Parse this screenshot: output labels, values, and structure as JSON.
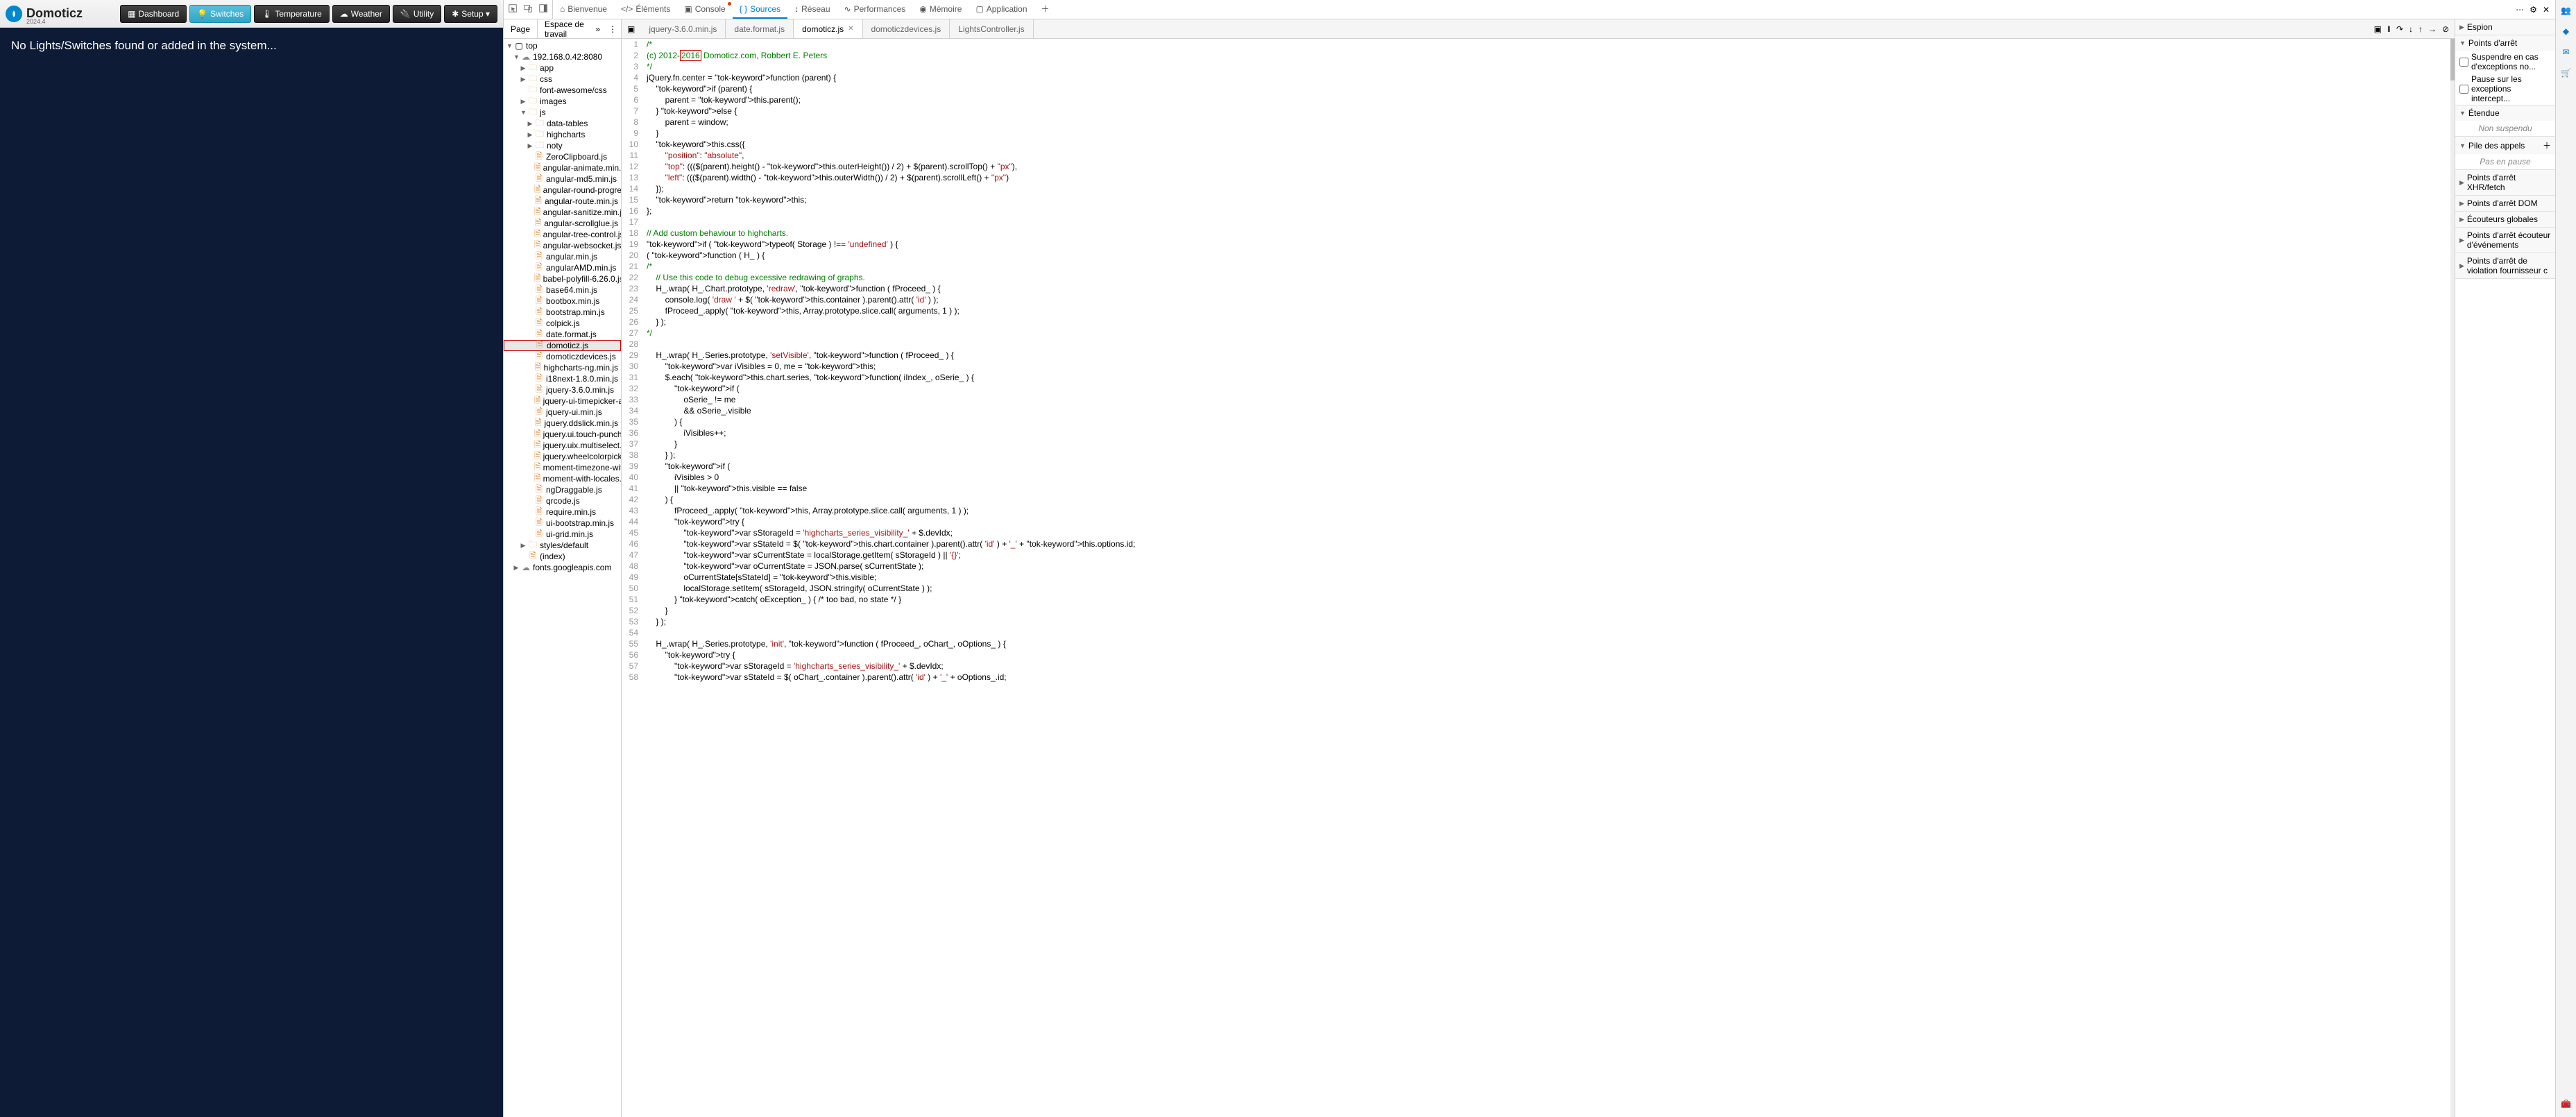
{
  "app": {
    "logo_text": "Domoticz",
    "version": "2024.4",
    "nav": {
      "dashboard": "Dashboard",
      "switches": "Switches",
      "temperature": "Temperature",
      "weather": "Weather",
      "utility": "Utility",
      "setup": "Setup ▾"
    },
    "content_message": "No Lights/Switches found or added in the system..."
  },
  "devtools": {
    "tabs": {
      "welcome": "Bienvenue",
      "elements": "Éléments",
      "console": "Console",
      "sources": "Sources",
      "network": "Réseau",
      "performance": "Performances",
      "memory": "Mémoire",
      "application": "Application"
    },
    "filenav": {
      "page_tab": "Page",
      "workspace_tab": "Espace de travail",
      "root": "top",
      "origin": "192.168.0.42:8080",
      "folders": {
        "app": "app",
        "css": "css",
        "fontawesome": "font-awesome/css",
        "images": "images",
        "js": "js",
        "datatables": "data-tables",
        "highcharts": "highcharts",
        "noty": "noty",
        "styles": "styles/default"
      },
      "files": [
        "ZeroClipboard.js",
        "angular-animate.min.js",
        "angular-md5.min.js",
        "angular-round-progress-directive.js",
        "angular-route.min.js",
        "angular-sanitize.min.js",
        "angular-scrollglue.js",
        "angular-tree-control.js",
        "angular-websocket.js",
        "angular.min.js",
        "angularAMD.min.js",
        "babel-polyfill-6.26.0.js",
        "base64.min.js",
        "bootbox.min.js",
        "bootstrap.min.js",
        "colpick.js",
        "date.format.js",
        "domoticz.js",
        "domoticzdevices.js",
        "highcharts-ng.min.js",
        "i18next-1.8.0.min.js",
        "jquery-3.6.0.min.js",
        "jquery-ui-timepicker-addon.js",
        "jquery-ui.min.js",
        "jquery.ddslick.min.js",
        "jquery.ui.touch-punch.min.js",
        "jquery.uix.multiselect.min.js",
        "jquery.wheelcolorpicker.js",
        "moment-timezone-with-data.min.js",
        "moment-with-locales.min.js",
        "ngDraggable.js",
        "qrcode.js",
        "require.min.js",
        "ui-bootstrap.min.js",
        "ui-grid.min.js"
      ],
      "index": "(index)",
      "fonts": "fonts.googleapis.com"
    },
    "editor_tabs": {
      "jquery": "jquery-3.6.0.min.js",
      "dateformat": "date.format.js",
      "domoticz": "domoticz.js",
      "domoticzdev": "domoticzdevices.js",
      "lights": "LightsController.js"
    },
    "code": {
      "l1": "/*",
      "l2a": "(c) 2012-",
      "l2b": "2016",
      "l2c": " Domoticz.com, Robbert E. Peters",
      "l3": "*/",
      "l4": "jQuery.fn.center = function (parent) {",
      "l5": "    if (parent) {",
      "l6": "        parent = this.parent();",
      "l7": "    } else {",
      "l8": "        parent = window;",
      "l9": "    }",
      "l10": "    this.css({",
      "l11": "        \"position\": \"absolute\",",
      "l12": "        \"top\": ((($(parent).height() - this.outerHeight()) / 2) + $(parent).scrollTop() + \"px\"),",
      "l13": "        \"left\": ((($(parent).width() - this.outerWidth()) / 2) + $(parent).scrollLeft() + \"px\")",
      "l14": "    });",
      "l15": "    return this;",
      "l16": "};",
      "l17": "",
      "l18": "// Add custom behaviour to highcharts.",
      "l19": "if ( typeof( Storage ) !== 'undefined' ) {",
      "l20": "( function ( H_ ) {",
      "l21": "/*",
      "l22": "    // Use this code to debug excessive redrawing of graphs.",
      "l23": "    H_.wrap( H_.Chart.prototype, 'redraw', function ( fProceed_ ) {",
      "l24": "        console.log( 'draw ' + $( this.container ).parent().attr( 'id' ) );",
      "l25": "        fProceed_.apply( this, Array.prototype.slice.call( arguments, 1 ) );",
      "l26": "    } );",
      "l27": "*/",
      "l28": "",
      "l29": "    H_.wrap( H_.Series.prototype, 'setVisible', function ( fProceed_ ) {",
      "l30": "        var iVisibles = 0, me = this;",
      "l31": "        $.each( this.chart.series, function( iIndex_, oSerie_ ) {",
      "l32": "            if (",
      "l33": "                oSerie_ != me",
      "l34": "                && oSerie_.visible",
      "l35": "            ) {",
      "l36": "                iVisibles++;",
      "l37": "            }",
      "l38": "        } );",
      "l39": "        if (",
      "l40": "            iVisibles > 0",
      "l41": "            || this.visible == false",
      "l42": "        ) {",
      "l43": "            fProceed_.apply( this, Array.prototype.slice.call( arguments, 1 ) );",
      "l44": "            try {",
      "l45": "                var sStorageId = 'highcharts_series_visibility_' + $.devIdx;",
      "l46": "                var sStateId = $( this.chart.container ).parent().attr( 'id' ) + '_' + this.options.id;",
      "l47": "                var sCurrentState = localStorage.getItem( sStorageId ) || '{}';",
      "l48": "                var oCurrentState = JSON.parse( sCurrentState );",
      "l49": "                oCurrentState[sStateId] = this.visible;",
      "l50": "                localStorage.setItem( sStorageId, JSON.stringify( oCurrentState ) );",
      "l51": "            } catch( oException_ ) { /* too bad, no state */ }",
      "l52": "        }",
      "l53": "    } );",
      "l54": "",
      "l55": "    H_.wrap( H_.Series.prototype, 'init', function ( fProceed_, oChart_, oOptions_ ) {",
      "l56": "        try {",
      "l57": "            var sStorageId = 'highcharts_series_visibility_' + $.devIdx;",
      "l58": "            var sStateId = $( oChart_.container ).parent().attr( 'id' ) + '_' + oOptions_.id;"
    },
    "sidebar": {
      "espion": "Espion",
      "breakpoints": "Points d'arrêt",
      "suspend_exc": "Suspendre en cas d'exceptions no...",
      "pause_exc": "Pause sur les exceptions intercept...",
      "scope": "Étendue",
      "not_suspended": "Non suspendu",
      "callstack": "Pile des appels",
      "not_paused": "Pas en pause",
      "xhr": "Points d'arrêt XHR/fetch",
      "dom": "Points d'arrêt DOM",
      "listeners": "Écouteurs globales",
      "event_bp": "Points d'arrêt écouteur d'événements",
      "violation_bp": "Points d'arrêt de violation fournisseur c"
    }
  }
}
